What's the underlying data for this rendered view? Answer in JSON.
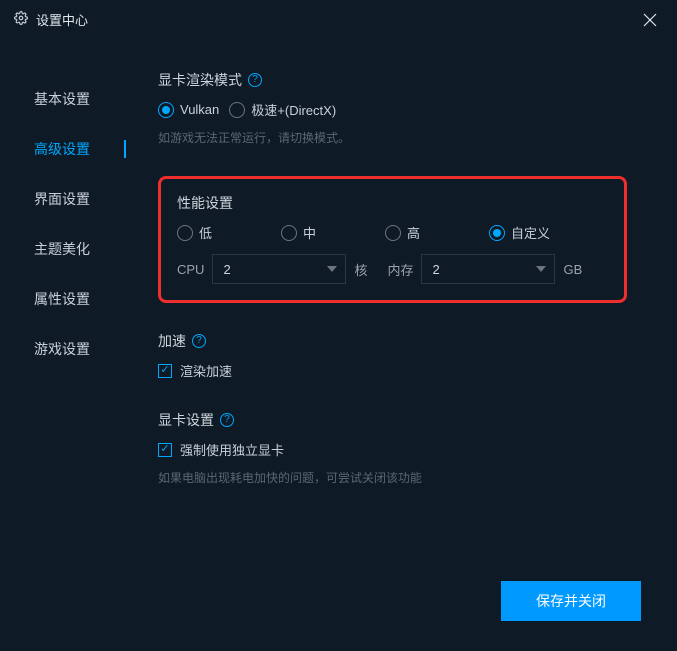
{
  "window": {
    "title": "设置中心"
  },
  "sidebar": {
    "items": [
      {
        "label": "基本设置"
      },
      {
        "label": "高级设置"
      },
      {
        "label": "界面设置"
      },
      {
        "label": "主题美化"
      },
      {
        "label": "属性设置"
      },
      {
        "label": "游戏设置"
      }
    ],
    "activeIndex": 1
  },
  "render": {
    "title": "显卡渲染模式",
    "options": {
      "vulkan": "Vulkan",
      "directx": "极速+(DirectX)"
    },
    "hint": "如游戏无法正常运行，请切换模式。"
  },
  "perf": {
    "title": "性能设置",
    "options": {
      "low": "低",
      "mid": "中",
      "high": "高",
      "custom": "自定义"
    },
    "cpuLabel": "CPU",
    "cpuValue": "2",
    "cpuUnit": "核",
    "memLabel": "内存",
    "memValue": "2",
    "memUnit": "GB"
  },
  "accel": {
    "title": "加速",
    "checkboxLabel": "渲染加速"
  },
  "gpu": {
    "title": "显卡设置",
    "checkboxLabel": "强制使用独立显卡",
    "hint": "如果电脑出现耗电加快的问题，可尝试关闭该功能"
  },
  "footer": {
    "save": "保存并关闭"
  }
}
